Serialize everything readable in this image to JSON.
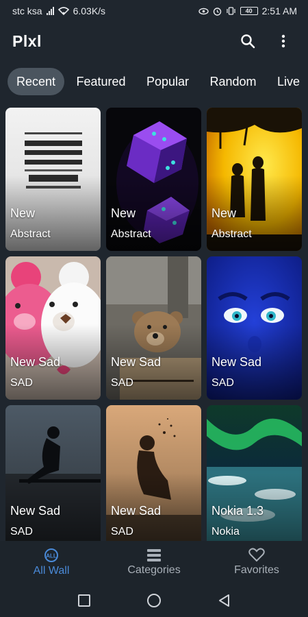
{
  "status_bar": {
    "carrier": "stc ksa",
    "speed": "6.03K/s",
    "battery": "40",
    "time": "2:51 AM"
  },
  "app_bar": {
    "title": "Plxl",
    "search_icon": "search-icon",
    "menu_icon": "more-vert-icon"
  },
  "tabs": [
    {
      "label": "Recent",
      "active": true
    },
    {
      "label": "Featured",
      "active": false
    },
    {
      "label": "Popular",
      "active": false
    },
    {
      "label": "Random",
      "active": false
    },
    {
      "label": "Live",
      "active": false
    }
  ],
  "wallpapers": [
    {
      "title": "New",
      "category": "Abstract"
    },
    {
      "title": "New",
      "category": "Abstract"
    },
    {
      "title": "New",
      "category": "Abstract"
    },
    {
      "title": "New Sad",
      "category": "SAD"
    },
    {
      "title": "New Sad",
      "category": "SAD"
    },
    {
      "title": "New Sad",
      "category": "SAD"
    },
    {
      "title": "New Sad",
      "category": "SAD"
    },
    {
      "title": "New Sad",
      "category": "SAD"
    },
    {
      "title": "Nokia 1.3",
      "category": "Nokia"
    }
  ],
  "bottom_nav": [
    {
      "label": "All Wall",
      "icon": "all-wall-icon",
      "active": true
    },
    {
      "label": "Categories",
      "icon": "categories-icon",
      "active": false
    },
    {
      "label": "Favorites",
      "icon": "heart-icon",
      "active": false
    }
  ],
  "colors": {
    "background": "#1f262e",
    "active_tab": "#4b555f",
    "accent": "#4a8ad8",
    "nav_inactive": "#a9b0b8"
  }
}
